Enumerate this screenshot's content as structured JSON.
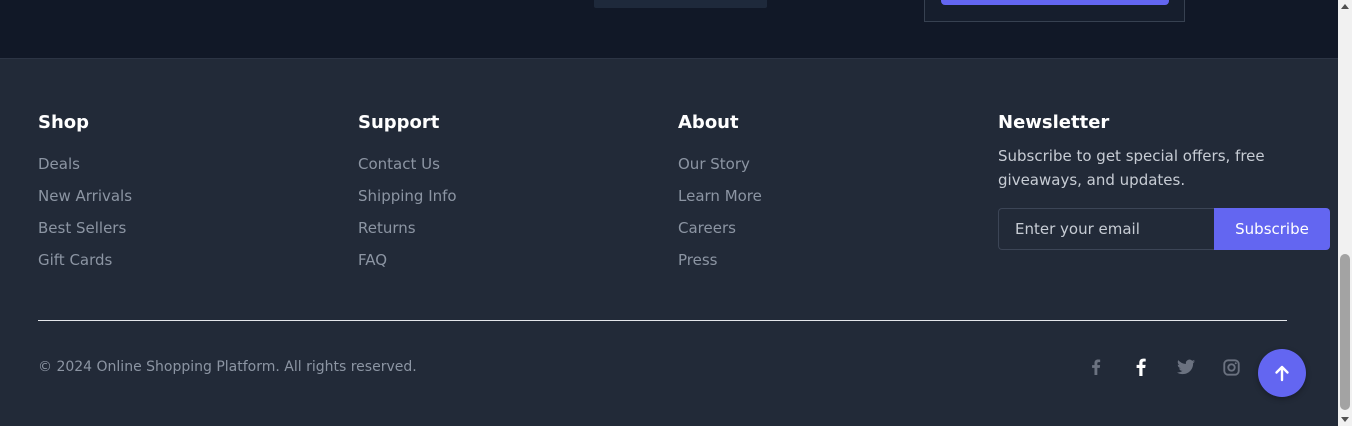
{
  "colors": {
    "accent": "#6366f1",
    "footer_bg": "#222a38",
    "top_bg": "#111827"
  },
  "columns": [
    {
      "heading": "Shop",
      "links": [
        "Deals",
        "New Arrivals",
        "Best Sellers",
        "Gift Cards"
      ]
    },
    {
      "heading": "Support",
      "links": [
        "Contact Us",
        "Shipping Info",
        "Returns",
        "FAQ"
      ]
    },
    {
      "heading": "About",
      "links": [
        "Our Story",
        "Learn More",
        "Careers",
        "Press"
      ]
    }
  ],
  "newsletter": {
    "heading": "Newsletter",
    "text": "Subscribe to get special offers, free giveaways, and updates.",
    "placeholder": "Enter your email",
    "button_label": "Subscribe"
  },
  "copyright": "© 2024 Online Shopping Platform. All rights reserved.",
  "social_icons": [
    "facebook-icon",
    "facebook-icon",
    "twitter-icon",
    "instagram-icon"
  ],
  "scroll_top_icon": "arrow-up-icon"
}
